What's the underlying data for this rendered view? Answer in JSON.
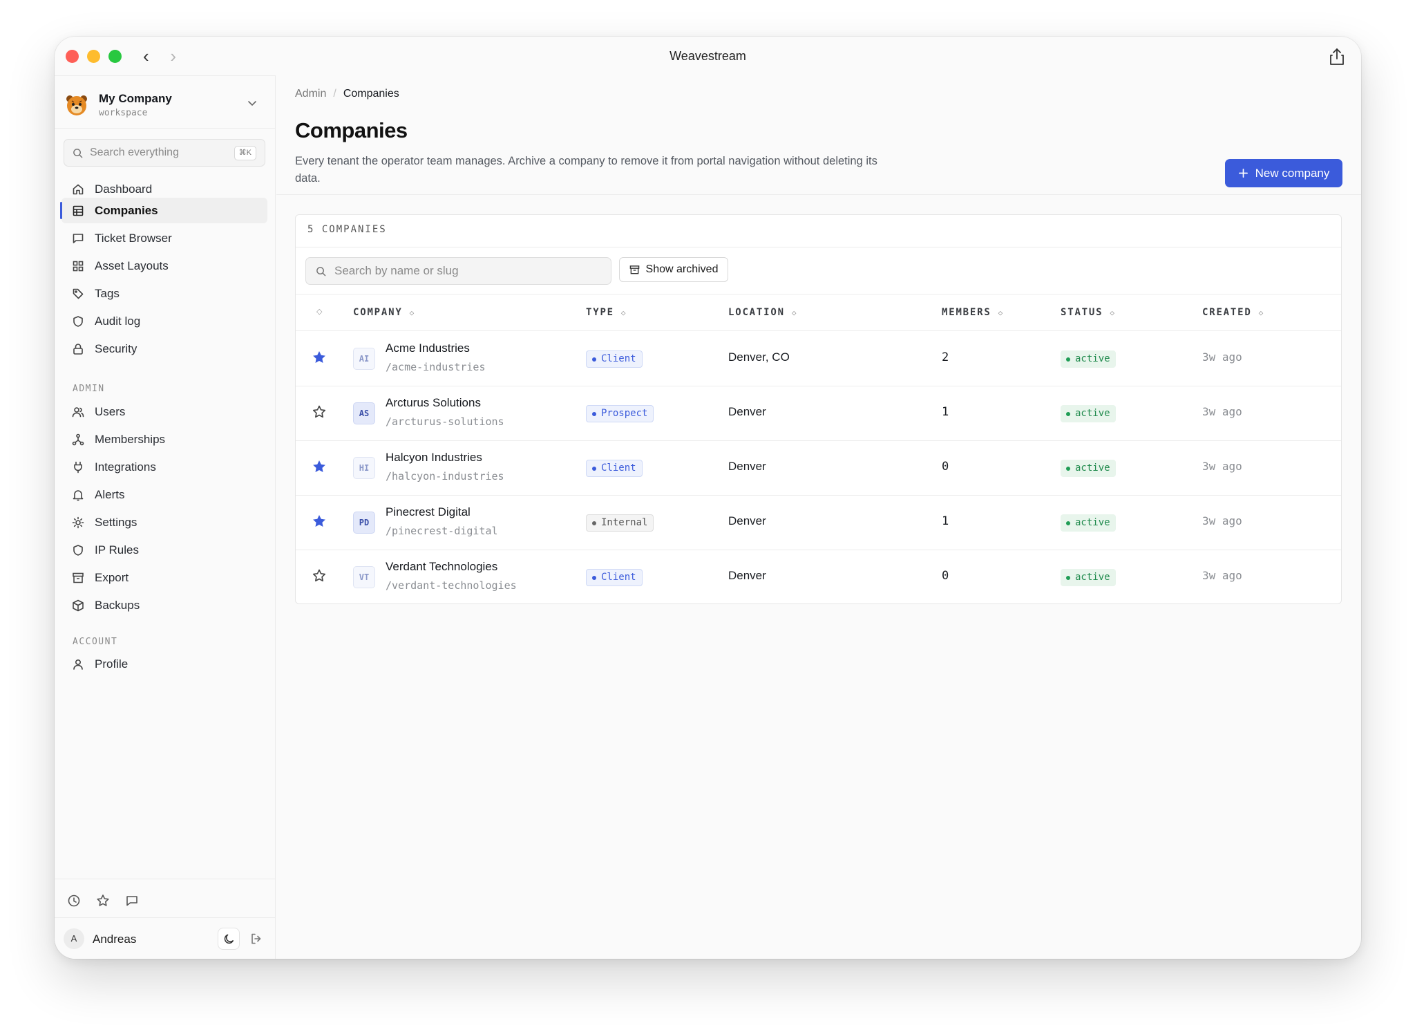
{
  "window": {
    "title": "Weavestream"
  },
  "sidebar": {
    "workspace": {
      "name": "My Company",
      "subtitle": "workspace"
    },
    "search": {
      "placeholder": "Search everything",
      "shortcut": "⌘K"
    },
    "items": [
      {
        "label": "Dashboard",
        "icon": "home-icon",
        "active": false
      },
      {
        "label": "Companies",
        "icon": "table-icon",
        "active": true
      },
      {
        "label": "Ticket Browser",
        "icon": "message-square-icon",
        "active": false
      },
      {
        "label": "Asset Layouts",
        "icon": "grid-icon",
        "active": false
      },
      {
        "label": "Tags",
        "icon": "tag-icon",
        "active": false
      },
      {
        "label": "Audit log",
        "icon": "shield-icon",
        "active": false
      },
      {
        "label": "Security",
        "icon": "lock-icon",
        "active": false
      }
    ],
    "admin_label": "ADMIN",
    "admin_items": [
      {
        "label": "Users",
        "icon": "users-icon"
      },
      {
        "label": "Memberships",
        "icon": "network-icon"
      },
      {
        "label": "Integrations",
        "icon": "plug-icon"
      },
      {
        "label": "Alerts",
        "icon": "bell-icon"
      },
      {
        "label": "Settings",
        "icon": "sun-gear-icon"
      },
      {
        "label": "IP Rules",
        "icon": "shield-icon"
      },
      {
        "label": "Export",
        "icon": "archive-icon"
      },
      {
        "label": "Backups",
        "icon": "box-icon"
      }
    ],
    "account_label": "ACCOUNT",
    "account_items": [
      {
        "label": "Profile",
        "icon": "user-icon"
      }
    ],
    "user": {
      "initial": "A",
      "name": "Andreas"
    }
  },
  "main": {
    "breadcrumb": {
      "parent": "Admin",
      "separator": "/",
      "current": "Companies"
    },
    "title": "Companies",
    "description": "Every tenant the operator team manages. Archive a company to remove it from portal navigation without deleting its data.",
    "new_button": "New company",
    "card": {
      "count_label": "5 COMPANIES",
      "search_placeholder": "Search by name or slug",
      "show_archived": "Show archived",
      "columns": {
        "company": "COMPANY",
        "type": "TYPE",
        "location": "LOCATION",
        "members": "MEMBERS",
        "status": "STATUS",
        "created": "CREATED"
      },
      "rows": [
        {
          "starred": true,
          "initials": "AI",
          "initials_strong": false,
          "name": "Acme Industries",
          "slug": "/acme-industries",
          "type": "Client",
          "type_kind": "client",
          "location": "Denver, CO",
          "members": "2",
          "status": "active",
          "created": "3w ago"
        },
        {
          "starred": false,
          "initials": "AS",
          "initials_strong": true,
          "name": "Arcturus Solutions",
          "slug": "/arcturus-solutions",
          "type": "Prospect",
          "type_kind": "prospect",
          "location": "Denver",
          "members": "1",
          "status": "active",
          "created": "3w ago"
        },
        {
          "starred": true,
          "initials": "HI",
          "initials_strong": false,
          "name": "Halcyon Industries",
          "slug": "/halcyon-industries",
          "type": "Client",
          "type_kind": "client",
          "location": "Denver",
          "members": "0",
          "status": "active",
          "created": "3w ago"
        },
        {
          "starred": true,
          "initials": "PD",
          "initials_strong": true,
          "name": "Pinecrest Digital",
          "slug": "/pinecrest-digital",
          "type": "Internal",
          "type_kind": "internal",
          "location": "Denver",
          "members": "1",
          "status": "active",
          "created": "3w ago"
        },
        {
          "starred": false,
          "initials": "VT",
          "initials_strong": false,
          "name": "Verdant Technologies",
          "slug": "/verdant-technologies",
          "type": "Client",
          "type_kind": "client",
          "location": "Denver",
          "members": "0",
          "status": "active",
          "created": "3w ago"
        }
      ]
    }
  },
  "colors": {
    "accent": "#3b5bdb",
    "star_filled": "#3b5bdb",
    "status_active": "#1f8a4c"
  }
}
